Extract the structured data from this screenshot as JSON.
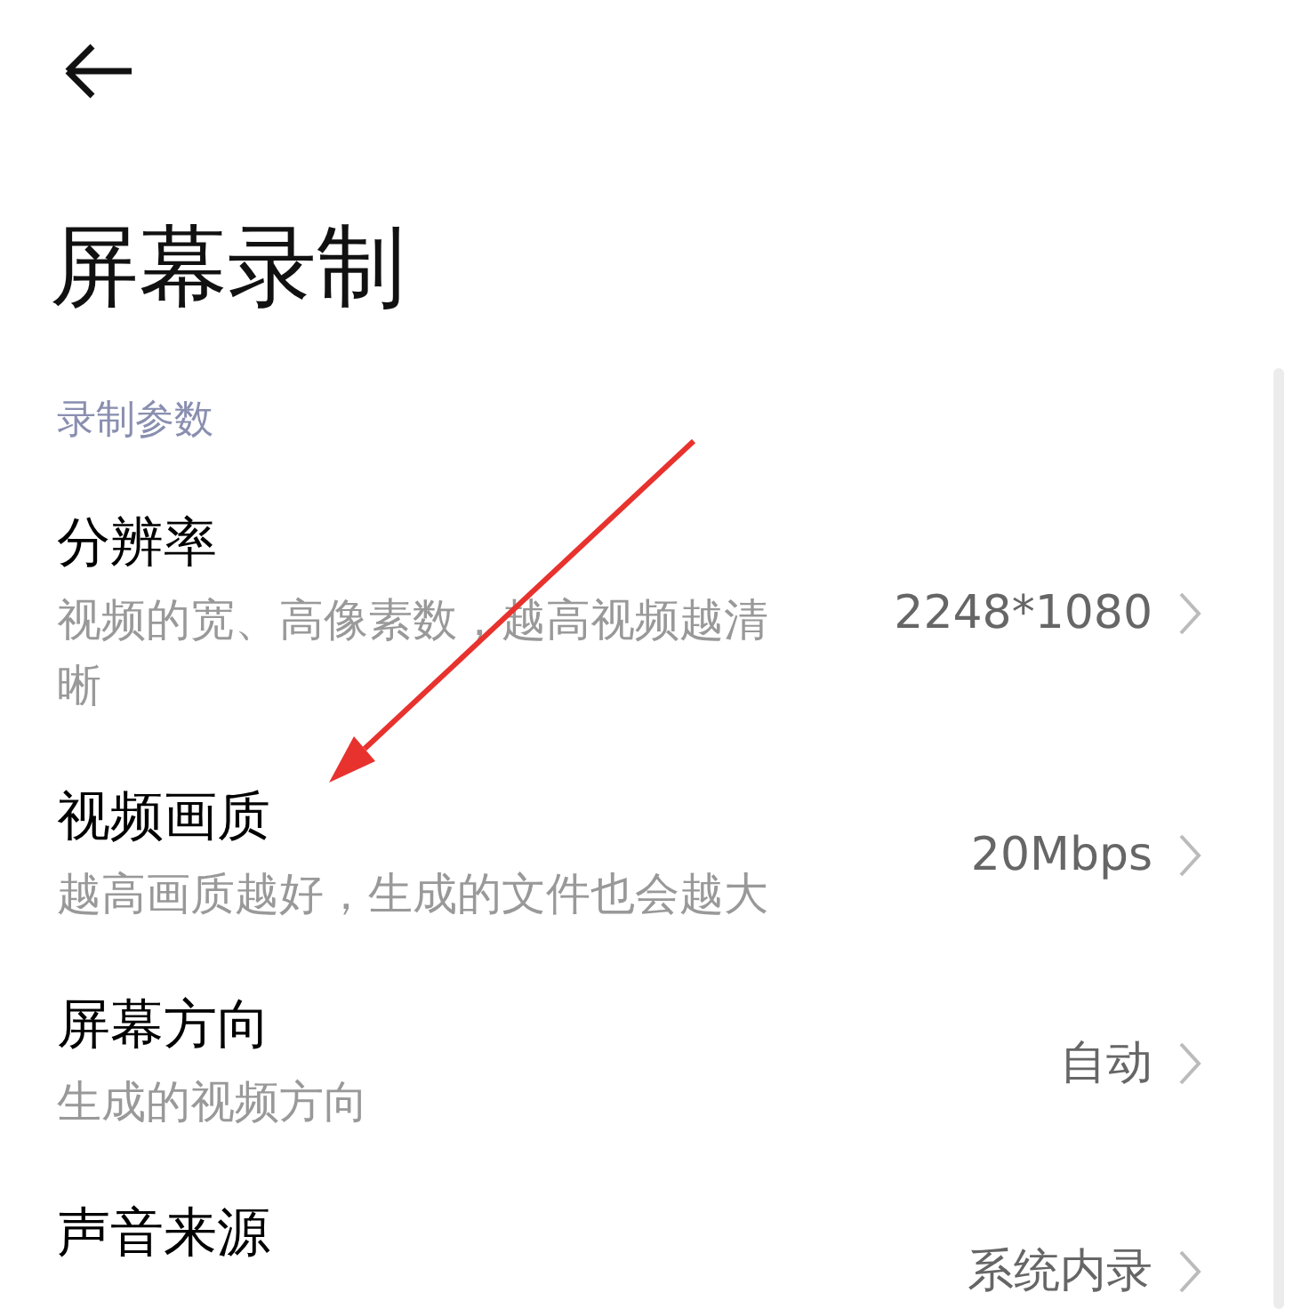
{
  "back_button": {
    "kind": "back"
  },
  "title": "屏幕录制",
  "section": {
    "label": "录制参数",
    "items": [
      {
        "title": "分辨率",
        "subtitle": "视频的宽、高像素数，越高视频越清晰",
        "value": "2248*1080"
      },
      {
        "title": "视频画质",
        "subtitle": "越高画质越好，生成的文件也会越大",
        "value": "20Mbps"
      },
      {
        "title": "屏幕方向",
        "subtitle": "生成的视频方向",
        "value": "自动"
      },
      {
        "title": "声音来源",
        "value": "系统内录"
      }
    ]
  }
}
